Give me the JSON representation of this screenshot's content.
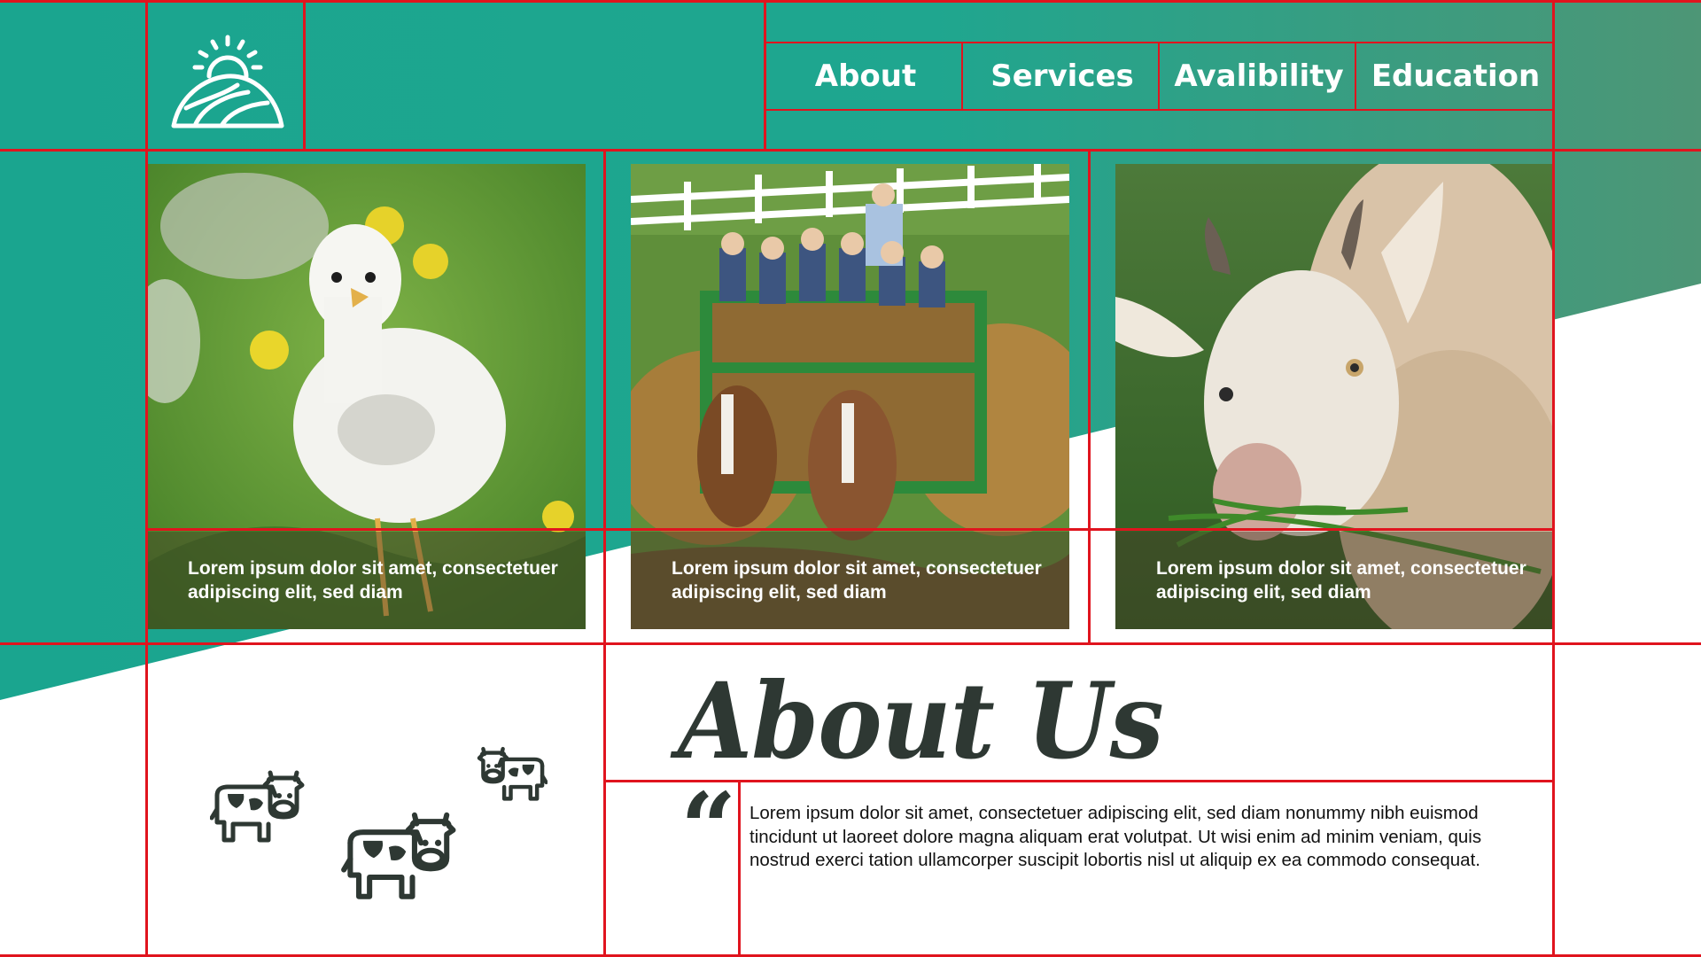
{
  "colors": {
    "teal": "#1aa58f",
    "teal_light": "#48987a",
    "grid_red": "#e0141e",
    "dark_text": "#2e3833",
    "white": "#ffffff"
  },
  "logo": {
    "icon": "sunrise-farm-icon"
  },
  "nav": {
    "items": [
      {
        "label": "About"
      },
      {
        "label": "Services"
      },
      {
        "label": "Avalibility"
      },
      {
        "label": "Education"
      }
    ]
  },
  "cards": [
    {
      "image": "chick-photo",
      "caption": "Lorem ipsum dolor sit amet, consectetuer adipiscing elit, sed diam"
    },
    {
      "image": "hay-wagon-photo",
      "caption": "Lorem ipsum dolor sit amet, consectetuer adipiscing elit, sed diam"
    },
    {
      "image": "goat-photo",
      "caption": "Lorem ipsum dolor sit amet, consectetuer adipiscing elit, sed diam"
    }
  ],
  "about": {
    "title": "About Us",
    "quote_mark": "“",
    "body": "Lorem ipsum dolor sit amet, consectetuer adipiscing elit, sed diam nonummy nibh euismod tincidunt ut laoreet dolore magna aliquam erat volutpat. Ut wisi enim ad minim veniam, quis nostrud exerci tation ullamcorper suscipit lobortis nisl ut aliquip ex ea commodo consequat."
  },
  "decorations": {
    "icons": [
      "cow-icon",
      "cow-icon",
      "cow-icon"
    ]
  }
}
